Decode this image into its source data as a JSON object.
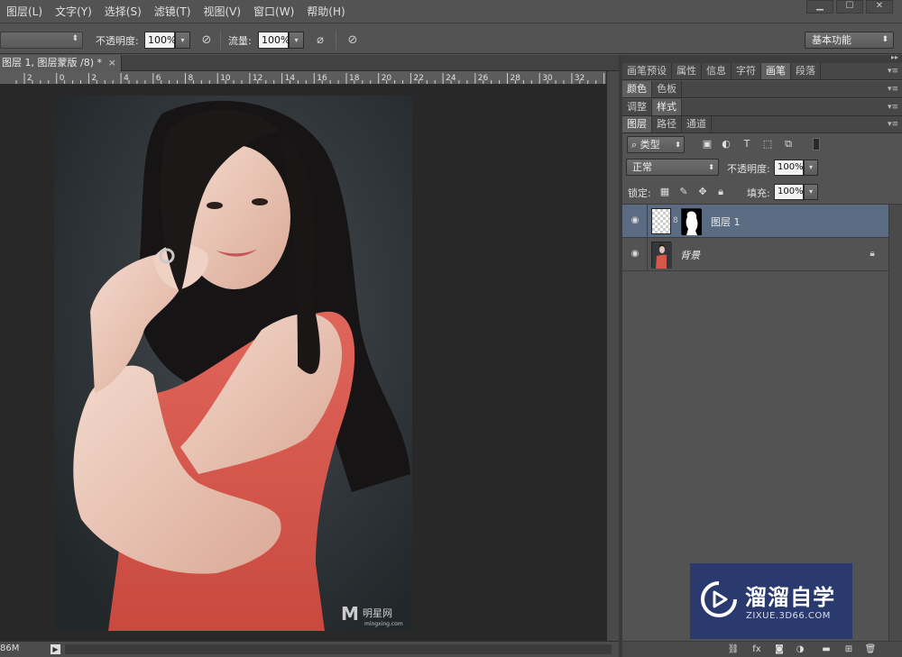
{
  "menu": [
    "图层(L)",
    "文字(Y)",
    "选择(S)",
    "滤镜(T)",
    "视图(V)",
    "窗口(W)",
    "帮助(H)"
  ],
  "window_controls": [
    "▁",
    "☐",
    "✕"
  ],
  "options": {
    "opacity_label": "不透明度:",
    "opacity_value": "100%",
    "flow_label": "流量:",
    "flow_value": "100%",
    "workspace": "基本功能"
  },
  "document": {
    "tab_title": "图层 1, 图层蒙版 /8) *",
    "tab_close": "×",
    "ruler_ticks": [
      "2",
      "0",
      "2",
      "4",
      "6",
      "8",
      "10",
      "12",
      "14",
      "16",
      "18",
      "20",
      "22",
      "24",
      "26",
      "28",
      "30",
      "32",
      "34"
    ],
    "status_size": "86M",
    "photo_watermark": "明星网",
    "photo_watermark_sub": "mingxing.com"
  },
  "panel_tabs_row1": [
    "画笔预设",
    "属性",
    "信息",
    "字符",
    "画笔",
    "段落"
  ],
  "panel_tabs_row1_active": "画笔",
  "panel_tabs_row2": [
    "颜色",
    "色板"
  ],
  "panel_tabs_row3": [
    "调整",
    "样式"
  ],
  "panel_tabs_row4": [
    "图层",
    "路径",
    "通道"
  ],
  "layers_panel": {
    "filter_type": "类型",
    "blend_mode": "正常",
    "opacity_label": "不透明度:",
    "opacity_value": "100%",
    "lock_label": "锁定:",
    "fill_label": "填充:",
    "fill_value": "100%",
    "layers": [
      {
        "name": "图层 1",
        "selected": true,
        "has_mask": true,
        "locked": false
      },
      {
        "name": "背景",
        "selected": false,
        "has_mask": false,
        "locked": true
      }
    ]
  },
  "footer_icons": [
    "link-icon",
    "fx-icon",
    "mask-icon",
    "adjustment-icon",
    "folder-icon",
    "new-layer-icon",
    "trash-icon"
  ],
  "watermark": {
    "title": "溜溜自学",
    "url": "ZIXUE.3D66.COM",
    "color": "#2b3a6e"
  }
}
